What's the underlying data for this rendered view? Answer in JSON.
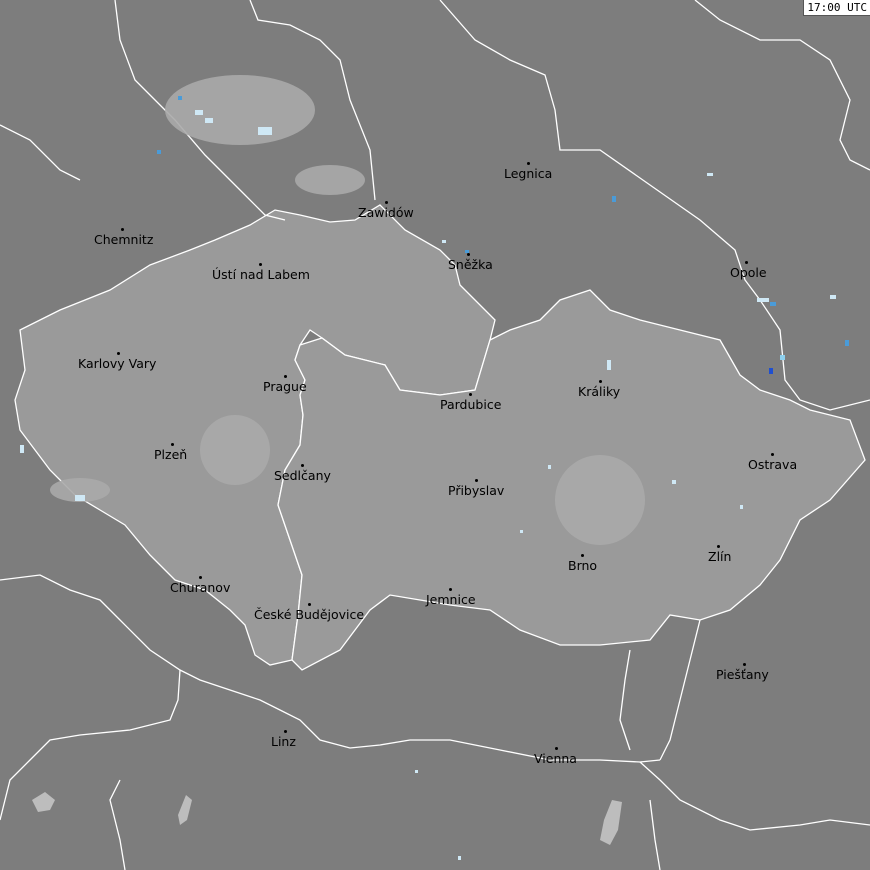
{
  "timestamp": "17:00 UTC",
  "colors": {
    "background": "#7d7d7d",
    "country_fill": "#9a9a9a",
    "border": "#ffffff",
    "lake": "#bdbdbd",
    "strike_light": "#cfe8f5",
    "strike_blue": "#4a9bd8"
  },
  "cities": [
    {
      "name": "Legnica"
    },
    {
      "name": "Zawidów"
    },
    {
      "name": "Chemnitz"
    },
    {
      "name": "Ústí nad Labem"
    },
    {
      "name": "Sněžka"
    },
    {
      "name": "Opole"
    },
    {
      "name": "Karlovy Vary"
    },
    {
      "name": "Prague"
    },
    {
      "name": "Králiky"
    },
    {
      "name": "Pardubice"
    },
    {
      "name": "Plzeň"
    },
    {
      "name": "Ostrava"
    },
    {
      "name": "Sedlčany"
    },
    {
      "name": "Přibyslav"
    },
    {
      "name": "Zlín"
    },
    {
      "name": "Brno"
    },
    {
      "name": "Churanov"
    },
    {
      "name": "Jemnice"
    },
    {
      "name": "České Budějovice"
    },
    {
      "name": "Piešťany"
    },
    {
      "name": "Linz"
    },
    {
      "name": "Vienna"
    }
  ]
}
